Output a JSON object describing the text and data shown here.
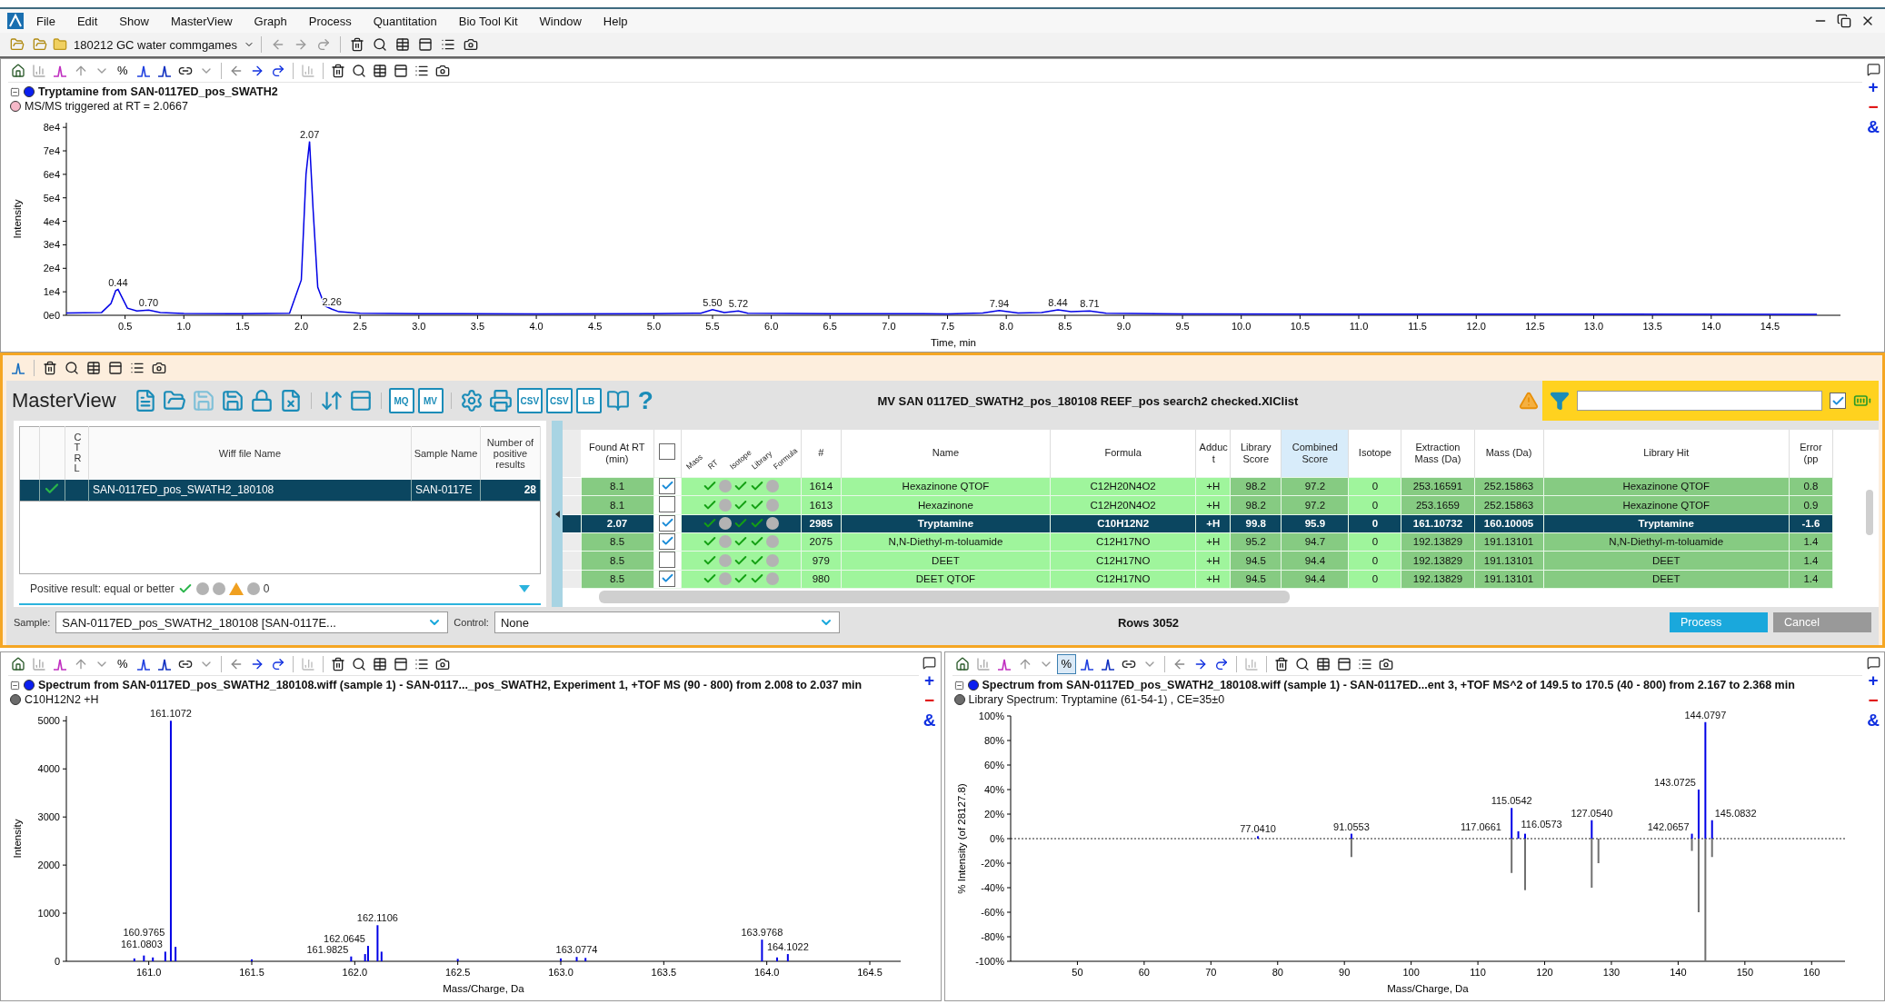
{
  "menu": [
    "File",
    "Edit",
    "Show",
    "MasterView",
    "Graph",
    "Process",
    "Quantitation",
    "Bio Tool Kit",
    "Window",
    "Help"
  ],
  "project": "180212 GC water commgames",
  "chromatogram_pane": {
    "percent_toggle": {
      "label": "%",
      "selected": false
    },
    "side_tools": [
      "+",
      "−",
      "&"
    ],
    "traces": [
      {
        "kind": "title",
        "text": "Tryptamine from SAN-0117ED_pos_SWATH2",
        "color": "#0a1ef0"
      },
      {
        "kind": "trace",
        "text": "MS/MS triggered at RT = 2.0667",
        "color": "#f5b8c8"
      }
    ],
    "chart_data": {
      "type": "line",
      "xlabel": "Time, min",
      "ylabel": "Intensity",
      "x": [
        0,
        0.3,
        0.38,
        0.42,
        0.44,
        0.47,
        0.52,
        0.6,
        0.7,
        0.8,
        1.0,
        1.5,
        1.9,
        2.0,
        2.04,
        2.07,
        2.1,
        2.14,
        2.2,
        2.26,
        2.32,
        2.5,
        3.0,
        4.0,
        5.0,
        5.4,
        5.5,
        5.6,
        5.72,
        5.8,
        6.5,
        7.5,
        7.8,
        7.94,
        8.1,
        8.3,
        8.44,
        8.55,
        8.71,
        8.85,
        9.5,
        11,
        13,
        14.9
      ],
      "series": [
        {
          "color": "#0000e6",
          "values": [
            1000,
            1200,
            5000,
            10500,
            11000,
            8000,
            3000,
            1800,
            2200,
            1200,
            800,
            700,
            900,
            15000,
            60000,
            74000,
            45000,
            12000,
            4000,
            2600,
            1500,
            900,
            700,
            600,
            700,
            900,
            2400,
            1200,
            1800,
            900,
            700,
            600,
            1000,
            2000,
            1000,
            1200,
            2300,
            1500,
            1800,
            900,
            600,
            500,
            500,
            400
          ]
        }
      ],
      "xlim": [
        0,
        15.1
      ],
      "ylim": [
        0,
        82000
      ],
      "xticks": [
        {
          "value": 0.5,
          "label": "0.5"
        },
        {
          "value": 1,
          "label": "1.0"
        },
        {
          "value": 1.5,
          "label": "1.5"
        },
        {
          "value": 2,
          "label": "2.0"
        },
        {
          "value": 2.5,
          "label": "2.5"
        },
        {
          "value": 3,
          "label": "3.0"
        },
        {
          "value": 3.5,
          "label": "3.5"
        },
        {
          "value": 4,
          "label": "4.0"
        },
        {
          "value": 4.5,
          "label": "4.5"
        },
        {
          "value": 5,
          "label": "5.0"
        },
        {
          "value": 5.5,
          "label": "5.5"
        },
        {
          "value": 6,
          "label": "6.0"
        },
        {
          "value": 6.5,
          "label": "6.5"
        },
        {
          "value": 7,
          "label": "7.0"
        },
        {
          "value": 7.5,
          "label": "7.5"
        },
        {
          "value": 8,
          "label": "8.0"
        },
        {
          "value": 8.5,
          "label": "8.5"
        },
        {
          "value": 9,
          "label": "9.0"
        },
        {
          "value": 9.5,
          "label": "9.5"
        },
        {
          "value": 10,
          "label": "10.0"
        },
        {
          "value": 10.5,
          "label": "10.5"
        },
        {
          "value": 11,
          "label": "11.0"
        },
        {
          "value": 11.5,
          "label": "11.5"
        },
        {
          "value": 12,
          "label": "12.0"
        },
        {
          "value": 12.5,
          "label": "12.5"
        },
        {
          "value": 13,
          "label": "13.0"
        },
        {
          "value": 13.5,
          "label": "13.5"
        },
        {
          "value": 14,
          "label": "14.0"
        },
        {
          "value": 14.5,
          "label": "14.5"
        }
      ],
      "yticks": [
        {
          "value": 0,
          "label": "0e0"
        },
        {
          "value": 10000,
          "label": "1e4"
        },
        {
          "value": 20000,
          "label": "2e4"
        },
        {
          "value": 30000,
          "label": "3e4"
        },
        {
          "value": 40000,
          "label": "4e4"
        },
        {
          "value": 50000,
          "label": "5e4"
        },
        {
          "value": 60000,
          "label": "6e4"
        },
        {
          "value": 70000,
          "label": "7e4"
        },
        {
          "value": 80000,
          "label": "8e4"
        }
      ],
      "annotations": [
        {
          "x": 0.44,
          "y": 11000,
          "text": "0.44"
        },
        {
          "x": 0.7,
          "y": 2200,
          "text": "0.70"
        },
        {
          "x": 2.07,
          "y": 74000,
          "text": "2.07"
        },
        {
          "x": 2.26,
          "y": 2600,
          "text": "2.26"
        },
        {
          "x": 5.5,
          "y": 2400,
          "text": "5.50"
        },
        {
          "x": 5.72,
          "y": 1800,
          "text": "5.72"
        },
        {
          "x": 7.94,
          "y": 2000,
          "text": "7.94"
        },
        {
          "x": 8.44,
          "y": 2300,
          "text": "8.44"
        },
        {
          "x": 8.71,
          "y": 1800,
          "text": "8.71"
        }
      ]
    }
  },
  "masterview": {
    "title": "MasterView",
    "tool_labels": [
      "MQ",
      "MV",
      "CSV",
      "CSV",
      "LB"
    ],
    "help": "?",
    "file_title": "MV SAN 0117ED_SWATH2_pos_180108 REEF_pos search2 checked.XIClist",
    "filter_checked": true,
    "samples_table": {
      "columns": [
        "CTRL",
        "Wiff file Name",
        "Sample Name",
        "Number of positive results"
      ],
      "rows": [
        {
          "selected": true,
          "checked": true,
          "file": "SAN-0117ED_pos_SWATH2_180108",
          "sample": "SAN-0117E",
          "count": "28"
        }
      ]
    },
    "positive_result": {
      "label": "Positive result: equal or better",
      "count": "0"
    },
    "results_table": {
      "select_all_checked": false,
      "flag_labels": [
        "Mass",
        "RT",
        "Isotope",
        "Library",
        "Formula"
      ],
      "columns": [
        {
          "label": "Found At RT (min)",
          "sorted": false
        },
        {
          "label": "#",
          "sorted": false
        },
        {
          "label": "Name",
          "sorted": false
        },
        {
          "label": "Formula",
          "sorted": false
        },
        {
          "label": "Adduct",
          "sorted": false
        },
        {
          "label": "Library Score",
          "sorted": false
        },
        {
          "label": "Combined Score",
          "sorted": true
        },
        {
          "label": "Isotope",
          "sorted": false
        },
        {
          "label": "Extraction Mass (Da)",
          "sorted": false
        },
        {
          "label": "Mass (Da)",
          "sorted": false
        },
        {
          "label": "Library Hit",
          "sorted": false
        },
        {
          "label": "Error (pp",
          "sorted": false
        }
      ],
      "rows": [
        {
          "selected": false,
          "checked": true,
          "flags": [
            true,
            false,
            true,
            true,
            false
          ],
          "rt": "8.1",
          "id": "1614",
          "name": "Hexazinone QTOF",
          "formula": "C12H20N4O2",
          "adduct": "+H",
          "library_score": "98.2",
          "combined_score": "97.2",
          "isotope": "0",
          "extraction_mass": "253.16591",
          "mass": "252.15863",
          "library_hit": "Hexazinone QTOF",
          "error": "0.8"
        },
        {
          "selected": false,
          "checked": false,
          "flags": [
            true,
            false,
            true,
            true,
            false
          ],
          "rt": "8.1",
          "id": "1613",
          "name": "Hexazinone",
          "formula": "C12H20N4O2",
          "adduct": "+H",
          "library_score": "98.2",
          "combined_score": "97.2",
          "isotope": "0",
          "extraction_mass": "253.1659",
          "mass": "252.15863",
          "library_hit": "Hexazinone QTOF",
          "error": "0.9"
        },
        {
          "selected": true,
          "checked": true,
          "flags": [
            true,
            false,
            true,
            true,
            false
          ],
          "rt": "2.07",
          "id": "2985",
          "name": "Tryptamine",
          "formula": "C10H12N2",
          "adduct": "+H",
          "library_score": "99.8",
          "combined_score": "95.9",
          "isotope": "0",
          "extraction_mass": "161.10732",
          "mass": "160.10005",
          "library_hit": "Tryptamine",
          "error": "-1.6"
        },
        {
          "selected": false,
          "checked": true,
          "flags": [
            true,
            false,
            true,
            true,
            false
          ],
          "rt": "8.5",
          "id": "2075",
          "name": "N,N-Diethyl-m-toluamide",
          "formula": "C12H17NO",
          "adduct": "+H",
          "library_score": "95.2",
          "combined_score": "94.7",
          "isotope": "0",
          "extraction_mass": "192.13829",
          "mass": "191.13101",
          "library_hit": "N,N-Diethyl-m-toluamide",
          "error": "1.4"
        },
        {
          "selected": false,
          "checked": false,
          "flags": [
            true,
            false,
            true,
            true,
            false
          ],
          "rt": "8.5",
          "id": "979",
          "name": "DEET",
          "formula": "C12H17NO",
          "adduct": "+H",
          "library_score": "94.5",
          "combined_score": "94.4",
          "isotope": "0",
          "extraction_mass": "192.13829",
          "mass": "191.13101",
          "library_hit": "DEET",
          "error": "1.4"
        },
        {
          "selected": false,
          "checked": true,
          "flags": [
            true,
            false,
            true,
            true,
            false
          ],
          "rt": "8.5",
          "id": "980",
          "name": "DEET QTOF",
          "formula": "C12H17NO",
          "adduct": "+H",
          "library_score": "94.5",
          "combined_score": "94.4",
          "isotope": "0",
          "extraction_mass": "192.13829",
          "mass": "191.13101",
          "library_hit": "DEET",
          "error": "1.4"
        }
      ]
    },
    "sample_select": {
      "label": "Sample:",
      "value": "SAN-0117ED_pos_SWATH2_180108   [SAN-0117E..."
    },
    "control_select": {
      "label": "Control:",
      "value": "None"
    },
    "rows_count": "Rows 3052",
    "buttons": [
      {
        "label": "Process",
        "disabled": false
      },
      {
        "label": "Cancel",
        "disabled": true
      }
    ]
  },
  "spectrum_panes": [
    {
      "percent_toggle": {
        "label": "%",
        "selected": false
      },
      "side_tools": [
        "+",
        "−",
        "&"
      ],
      "traces": [
        {
          "kind": "title",
          "text": "Spectrum from SAN-0117ED_pos_SWATH2_180108.wiff (sample 1) - SAN-0117..._pos_SWATH2, Experiment 1, +TOF MS (90 - 800) from 2.008 to 2.037 min",
          "color": "#0a1ef0"
        },
        {
          "kind": "trace",
          "text": "C10H12N2 +H",
          "color": "#6b6b6b"
        }
      ],
      "chart_data": {
        "type": "bar",
        "xlabel": "Mass/Charge, Da",
        "ylabel": "Intensity",
        "x": [
          160.93,
          160.9765,
          161.02,
          161.0803,
          161.1072,
          161.13,
          161.5,
          161.9825,
          162.05,
          162.0645,
          162.1106,
          162.13,
          162.5,
          163.0,
          163.0774,
          163.12,
          163.9768,
          164.05,
          164.1022
        ],
        "series": [
          {
            "color": "#0000e6",
            "values": [
              60,
              120,
              80,
              200,
              5000,
              300,
              40,
              100,
              150,
              320,
              750,
              200,
              50,
              60,
              90,
              70,
              450,
              80,
              150
            ]
          }
        ],
        "xlim": [
          160.6,
          164.65
        ],
        "ylim": [
          0,
          5100
        ],
        "xticks": [
          {
            "value": 161,
            "label": "161.0"
          },
          {
            "value": 161.5,
            "label": "161.5"
          },
          {
            "value": 162,
            "label": "162.0"
          },
          {
            "value": 162.5,
            "label": "162.5"
          },
          {
            "value": 163,
            "label": "163.0"
          },
          {
            "value": 163.5,
            "label": "163.5"
          },
          {
            "value": 164,
            "label": "164.0"
          },
          {
            "value": 164.5,
            "label": "164.5"
          }
        ],
        "yticks": [
          0,
          1000,
          2000,
          3000,
          4000,
          5000
        ],
        "annotations": [
          {
            "x": 161.1072,
            "y": 5000,
            "text": "161.1072"
          },
          {
            "x": 160.9765,
            "y": 120,
            "text": "160.9765"
          },
          {
            "x": 161.0803,
            "y": 200,
            "text": "161.0803"
          },
          {
            "x": 161.9825,
            "y": 100,
            "text": "161.9825"
          },
          {
            "x": 162.1106,
            "y": 750,
            "text": "162.1106"
          },
          {
            "x": 162.0645,
            "y": 320,
            "text": "162.0645"
          },
          {
            "x": 163.0774,
            "y": 90,
            "text": "163.0774"
          },
          {
            "x": 163.9768,
            "y": 450,
            "text": "163.9768"
          },
          {
            "x": 164.1022,
            "y": 150,
            "text": "164.1022"
          }
        ]
      }
    },
    {
      "percent_toggle": {
        "label": "%",
        "selected": true
      },
      "side_tools": [
        "+",
        "−",
        "&"
      ],
      "traces": [
        {
          "kind": "title",
          "text": "Spectrum from SAN-0117ED_pos_SWATH2_180108.wiff (sample 1) - SAN-0117ED...ent 3, +TOF MS^2 of 149.5 to 170.5 (40 - 800) from 2.167 to 2.368 min",
          "color": "#0a1ef0"
        },
        {
          "kind": "trace",
          "text": "Library Spectrum: Tryptamine (61-54-1) , CE=35±0",
          "color": "#6b6b6b"
        }
      ],
      "chart_data": {
        "type": "bar",
        "xlabel": "Mass/Charge, Da",
        "ylabel": "% Intensity (of 28127.8)",
        "series": [
          {
            "color": "#0000e6",
            "x": [
              77.041,
              91.0553,
              115.0542,
              116.0573,
              117.0661,
              127.054,
              142.0657,
              143.0725,
              144.0797,
              145.0832
            ],
            "values": [
              2,
              4,
              25,
              6,
              4,
              15,
              4,
              40,
              95,
              15
            ]
          },
          {
            "color": "#707070",
            "x": [
              91.05,
              115.05,
              117.07,
              127.05,
              128.06,
              142.06,
              143.07,
              144.08,
              145.08
            ],
            "values": [
              -15,
              -28,
              -42,
              -40,
              -20,
              -10,
              -60,
              -100,
              -15
            ]
          }
        ],
        "xlim": [
          40,
          165
        ],
        "ylim": [
          -100,
          100
        ],
        "xticks": [
          50,
          60,
          70,
          80,
          90,
          100,
          110,
          120,
          130,
          140,
          150,
          160
        ],
        "yticks": [
          {
            "value": -100,
            "label": "-100%"
          },
          {
            "value": -80,
            "label": "-80%"
          },
          {
            "value": -60,
            "label": "-60%"
          },
          {
            "value": -40,
            "label": "-40%"
          },
          {
            "value": -20,
            "label": "-20%"
          },
          {
            "value": 0,
            "label": "0%"
          },
          {
            "value": 20,
            "label": "20%"
          },
          {
            "value": 40,
            "label": "40%"
          },
          {
            "value": 60,
            "label": "60%"
          },
          {
            "value": 80,
            "label": "80%"
          },
          {
            "value": 100,
            "label": "100%"
          }
        ],
        "annotations": [
          {
            "x": 144.0797,
            "y": 95,
            "text": "144.0797"
          },
          {
            "x": 143.0725,
            "y": 40,
            "text": "143.0725"
          },
          {
            "x": 115.0542,
            "y": 25,
            "text": "115.0542"
          },
          {
            "x": 127.054,
            "y": 15,
            "text": "127.0540"
          },
          {
            "x": 145.0832,
            "y": 15,
            "text": "145.0832"
          },
          {
            "x": 116.0573,
            "y": 6,
            "text": "116.0573"
          },
          {
            "x": 91.0553,
            "y": 4,
            "text": "91.0553"
          },
          {
            "x": 117.0661,
            "y": 4,
            "text": "117.0661"
          },
          {
            "x": 142.0657,
            "y": 4,
            "text": "142.0657"
          },
          {
            "x": 77.041,
            "y": 2,
            "text": "77.0410"
          }
        ]
      }
    }
  ]
}
